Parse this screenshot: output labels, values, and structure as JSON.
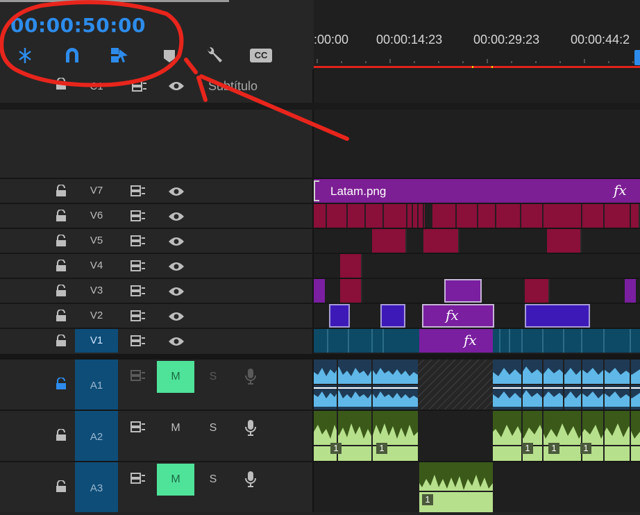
{
  "toolbar": {
    "timecode": "00:00:50:00",
    "tools": [
      "snap-icon",
      "magnet-icon",
      "linked-selection-icon",
      "marker-icon",
      "wrench-icon",
      "captions-icon"
    ],
    "cc_label": "CC"
  },
  "ruler": {
    "timecodes": [
      ":00:00",
      "00:00:14:23",
      "00:00:29:23",
      "00:00:44:2"
    ]
  },
  "tracks": {
    "c1": {
      "label": "C1",
      "name": "Subtítulo"
    },
    "video": [
      {
        "label": "V7"
      },
      {
        "label": "V6"
      },
      {
        "label": "V5"
      },
      {
        "label": "V4"
      },
      {
        "label": "V3"
      },
      {
        "label": "V2"
      },
      {
        "label": "V1"
      }
    ],
    "audio": [
      {
        "label": "A1",
        "m": "M",
        "s": "S"
      },
      {
        "label": "A2",
        "m": "M",
        "s": "S"
      },
      {
        "label": "A3",
        "m": "M",
        "s": "S"
      }
    ]
  },
  "clips": {
    "v7_name": "Latam.png",
    "fx": "fx",
    "clip_number": "1"
  },
  "colors": {
    "timecode": "#2d8ceb",
    "annotation": "#e8251c",
    "mute_on": "#4fe39a",
    "selected_track": "#0e4d78",
    "video_clip": "#8a0f39",
    "adjust_clip": "#7a1fa0",
    "audio_a1": "#5fb8e8",
    "audio_a2": "#b7e08c"
  }
}
